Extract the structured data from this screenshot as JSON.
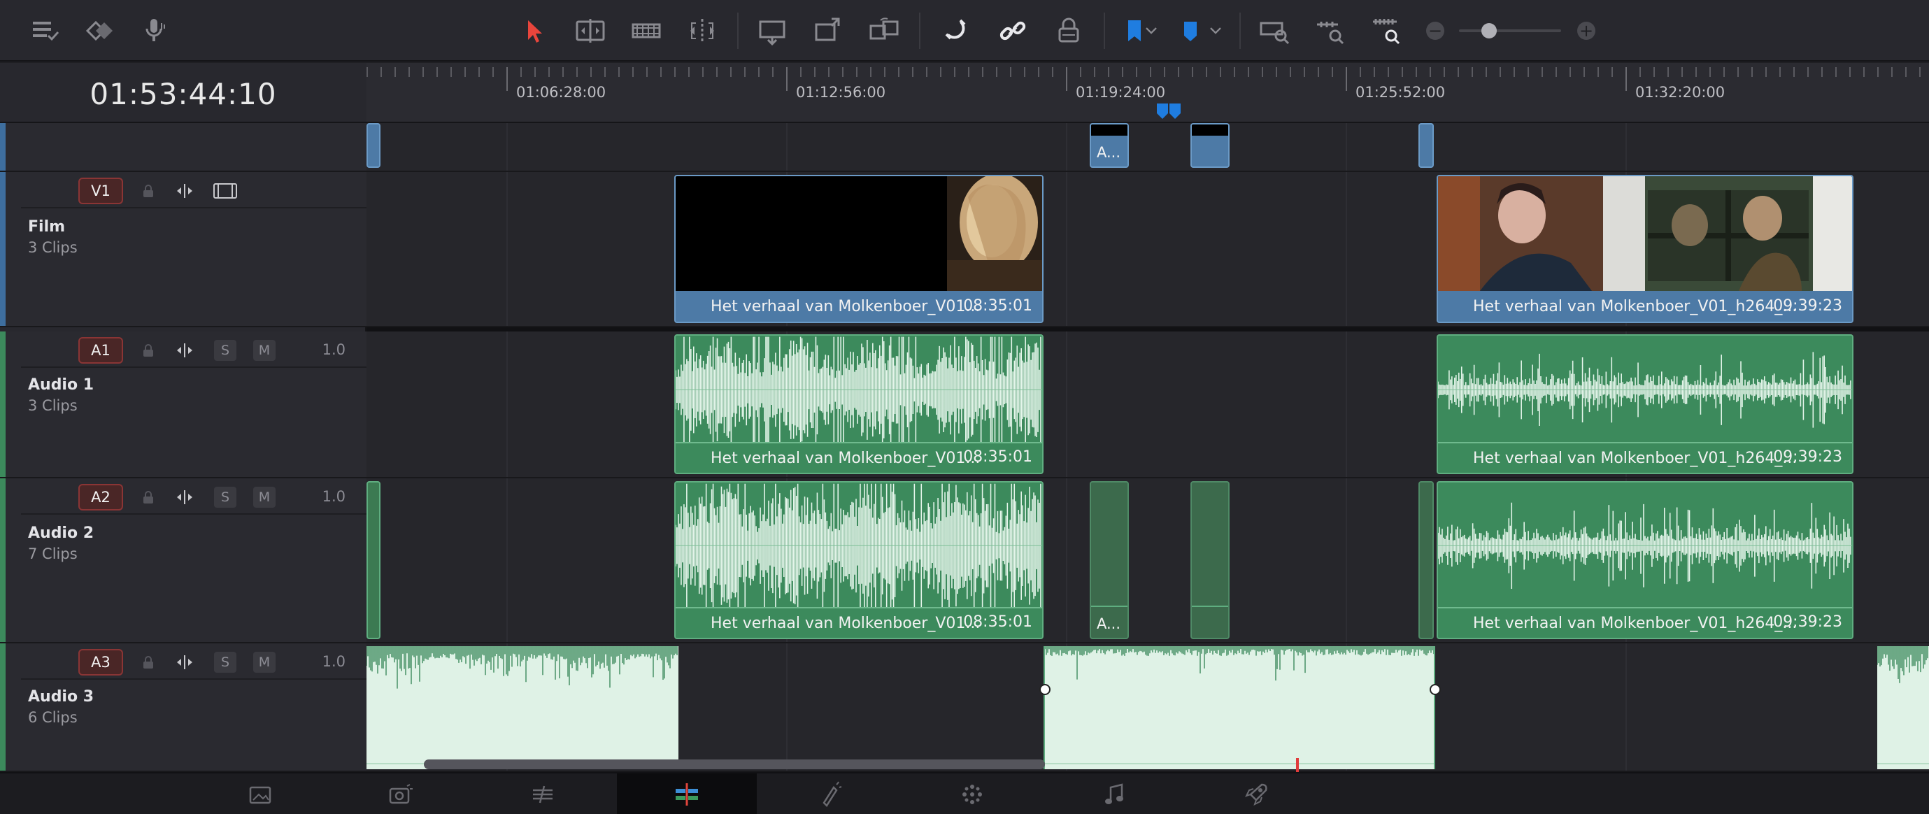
{
  "timecode": "01:53:44:10",
  "ruler": {
    "labels": [
      "01:06:28:00",
      "01:12:56:00",
      "01:19:24:00",
      "01:25:52:00",
      "01:32:20:00"
    ]
  },
  "toolbar": {
    "zoom_minus": "−",
    "zoom_plus": "+"
  },
  "tracks": {
    "v1": {
      "badge": "V1",
      "name": "Film",
      "count": "3 Clips"
    },
    "a1": {
      "badge": "A1",
      "name": "Audio 1",
      "count": "3 Clips",
      "volume": "1.0",
      "solo": "S",
      "mute": "M"
    },
    "a2": {
      "badge": "A2",
      "name": "Audio 2",
      "count": "7 Clips",
      "volume": "1.0",
      "solo": "S",
      "mute": "M"
    },
    "a3": {
      "badge": "A3",
      "name": "Audio 3",
      "count": "6 Clips",
      "volume": "1.0",
      "solo": "S",
      "mute": "M"
    }
  },
  "clips": {
    "clip1_name": "Het verhaal van Molkenboer_V01...",
    "clip1_duration": "08:35:01",
    "clip2_name": "Het verhaal van Molkenboer_V01_h264_...",
    "clip2_duration": "09:39:23",
    "small_label": "A..."
  },
  "colors": {
    "video_clip": "#4d7aa6",
    "audio_clip": "#3c8a5c",
    "badge_red": "#8a3535",
    "marker_blue": "#1f7de0"
  }
}
